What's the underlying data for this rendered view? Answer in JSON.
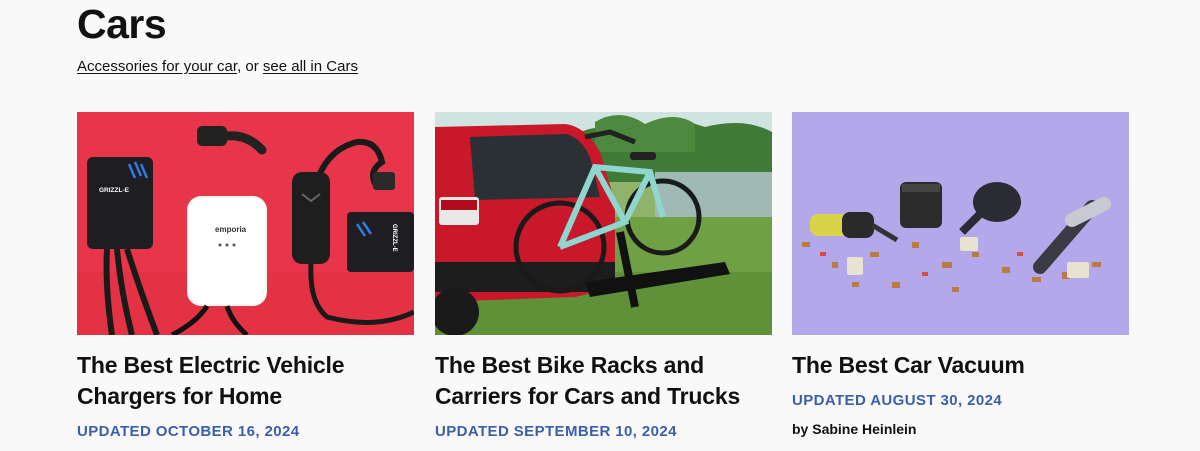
{
  "section": {
    "title": "Cars",
    "sub_link_1": "Accessories for your car",
    "sub_separator": ", or ",
    "sub_link_2": "see all in Cars"
  },
  "cards": [
    {
      "title_line1": "The Best Electric Vehicle",
      "title_line2": "Chargers for Home",
      "updated": "UPDATED OCTOBER 16, 2024",
      "image_text_1": "GRIZZL-E",
      "image_text_2": "emporia",
      "image_text_3": "GRIZZL-E"
    },
    {
      "title_line1": "The Best Bike Racks and",
      "title_line2": "Carriers for Cars and Trucks",
      "updated": "UPDATED SEPTEMBER 10, 2024"
    },
    {
      "title_line1": "The Best Car Vacuum",
      "updated": "UPDATED AUGUST 30, 2024",
      "byline_prefix": "by ",
      "byline_name": "Sabine Heinlein"
    }
  ],
  "colors": {
    "background": "#f9f9f9",
    "updated_text": "#3b5fa8",
    "ev_bg": "#e8354a",
    "vacuum_bg": "#b3a9ea"
  }
}
